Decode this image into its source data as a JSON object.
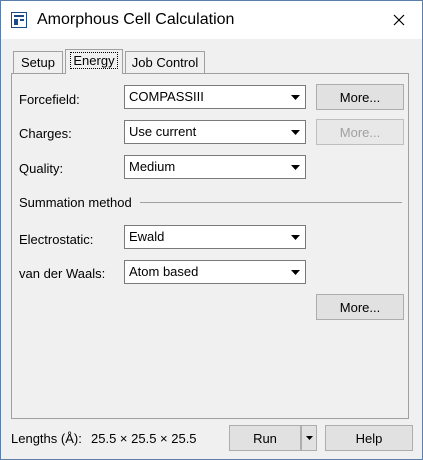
{
  "window": {
    "title": "Amorphous Cell Calculation",
    "close_icon": "close-icon"
  },
  "tabs": [
    {
      "label": "Setup",
      "active": false
    },
    {
      "label": "Energy",
      "active": true
    },
    {
      "label": "Job Control",
      "active": false
    }
  ],
  "energy": {
    "forcefield": {
      "label": "Forcefield:",
      "value": "COMPASSIII",
      "more": "More..."
    },
    "charges": {
      "label": "Charges:",
      "value": "Use current",
      "more": "More...",
      "more_enabled": false
    },
    "quality": {
      "label": "Quality:",
      "value": "Medium"
    },
    "summation_heading": "Summation method",
    "electrostatic": {
      "label": "Electrostatic:",
      "value": "Ewald"
    },
    "vdw": {
      "label": "van der Waals:",
      "value": "Atom based"
    },
    "summation_more": "More..."
  },
  "footer": {
    "lengths_label": "Lengths (Å):",
    "lengths_value": "25.5 × 25.5 × 25.5",
    "run": "Run",
    "help": "Help"
  }
}
